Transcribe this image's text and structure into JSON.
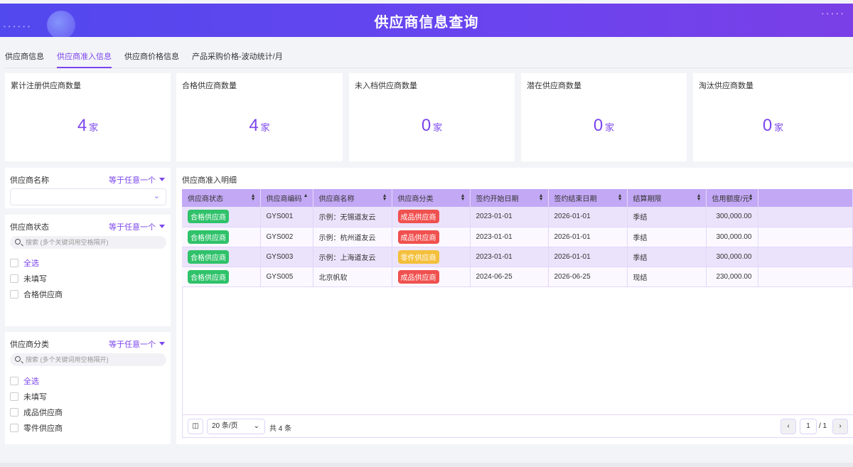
{
  "header": {
    "title": "供应商信息查询"
  },
  "tabs": [
    {
      "label": "供应商信息"
    },
    {
      "label": "供应商准入信息",
      "active": true
    },
    {
      "label": "供应商价格信息"
    },
    {
      "label": "产品采购价格-波动统计/月"
    }
  ],
  "stats": [
    {
      "label": "累计注册供应商数量",
      "value": "4",
      "unit": "家"
    },
    {
      "label": "合格供应商数量",
      "value": "4",
      "unit": "家"
    },
    {
      "label": "未入档供应商数量",
      "value": "0",
      "unit": "家"
    },
    {
      "label": "潜在供应商数量",
      "value": "0",
      "unit": "家"
    },
    {
      "label": "淘汰供应商数量",
      "value": "0",
      "unit": "家"
    }
  ],
  "filters": {
    "name": {
      "title": "供应商名称",
      "operator": "等于任意一个"
    },
    "status": {
      "title": "供应商状态",
      "operator": "等于任意一个",
      "search_placeholder": "搜索 (多个关键词用空格隔开)",
      "options": [
        "全选",
        "未填写",
        "合格供应商"
      ]
    },
    "category": {
      "title": "供应商分类",
      "operator": "等于任意一个",
      "search_placeholder": "搜索 (多个关键词用空格隔开)",
      "options": [
        "全选",
        "未填写",
        "成品供应商",
        "零件供应商"
      ]
    }
  },
  "table": {
    "title": "供应商准入明细",
    "columns": [
      "供应商状态",
      "供应商编码",
      "供应商名称",
      "供应商分类",
      "签约开始日期",
      "签约结束日期",
      "结算期限",
      "信用额度/元"
    ],
    "rows": [
      {
        "status": "合格供应商",
        "code": "GYS001",
        "name": "示例：无锡道友云",
        "category": "成品供应商",
        "start": "2023-01-01",
        "end": "2026-01-01",
        "term": "季结",
        "credit": "300,000.00"
      },
      {
        "status": "合格供应商",
        "code": "GYS002",
        "name": "示例：杭州道友云",
        "category": "成品供应商",
        "start": "2023-01-01",
        "end": "2026-01-01",
        "term": "季结",
        "credit": "300,000.00"
      },
      {
        "status": "合格供应商",
        "code": "GYS003",
        "name": "示例：上海道友云",
        "category": "零件供应商",
        "start": "2023-01-01",
        "end": "2026-01-01",
        "term": "季结",
        "credit": "300,000.00"
      },
      {
        "status": "合格供应商",
        "code": "GYS005",
        "name": "北京帆软",
        "category": "成品供应商",
        "start": "2024-06-25",
        "end": "2026-06-25",
        "term": "现结",
        "credit": "230,000.00"
      }
    ]
  },
  "pagination": {
    "page_size": "20 条/页",
    "total": "共 4 条",
    "page": "1",
    "pages": "/ 1"
  },
  "colors": {
    "accent": "#7b45ee",
    "green": "#2fc26a",
    "red": "#f0514f",
    "yellow": "#f4bf3a",
    "header": "#c3a8f5"
  }
}
